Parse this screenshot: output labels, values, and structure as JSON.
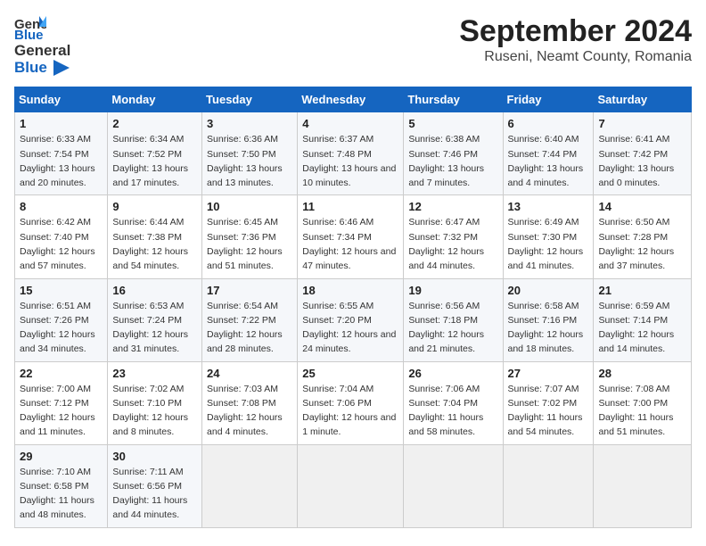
{
  "header": {
    "logo_general": "General",
    "logo_blue": "Blue",
    "title": "September 2024",
    "subtitle": "Ruseni, Neamt County, Romania"
  },
  "columns": [
    "Sunday",
    "Monday",
    "Tuesday",
    "Wednesday",
    "Thursday",
    "Friday",
    "Saturday"
  ],
  "weeks": [
    [
      {
        "day": "1",
        "sunrise": "Sunrise: 6:33 AM",
        "sunset": "Sunset: 7:54 PM",
        "daylight": "Daylight: 13 hours and 20 minutes."
      },
      {
        "day": "2",
        "sunrise": "Sunrise: 6:34 AM",
        "sunset": "Sunset: 7:52 PM",
        "daylight": "Daylight: 13 hours and 17 minutes."
      },
      {
        "day": "3",
        "sunrise": "Sunrise: 6:36 AM",
        "sunset": "Sunset: 7:50 PM",
        "daylight": "Daylight: 13 hours and 13 minutes."
      },
      {
        "day": "4",
        "sunrise": "Sunrise: 6:37 AM",
        "sunset": "Sunset: 7:48 PM",
        "daylight": "Daylight: 13 hours and 10 minutes."
      },
      {
        "day": "5",
        "sunrise": "Sunrise: 6:38 AM",
        "sunset": "Sunset: 7:46 PM",
        "daylight": "Daylight: 13 hours and 7 minutes."
      },
      {
        "day": "6",
        "sunrise": "Sunrise: 6:40 AM",
        "sunset": "Sunset: 7:44 PM",
        "daylight": "Daylight: 13 hours and 4 minutes."
      },
      {
        "day": "7",
        "sunrise": "Sunrise: 6:41 AM",
        "sunset": "Sunset: 7:42 PM",
        "daylight": "Daylight: 13 hours and 0 minutes."
      }
    ],
    [
      {
        "day": "8",
        "sunrise": "Sunrise: 6:42 AM",
        "sunset": "Sunset: 7:40 PM",
        "daylight": "Daylight: 12 hours and 57 minutes."
      },
      {
        "day": "9",
        "sunrise": "Sunrise: 6:44 AM",
        "sunset": "Sunset: 7:38 PM",
        "daylight": "Daylight: 12 hours and 54 minutes."
      },
      {
        "day": "10",
        "sunrise": "Sunrise: 6:45 AM",
        "sunset": "Sunset: 7:36 PM",
        "daylight": "Daylight: 12 hours and 51 minutes."
      },
      {
        "day": "11",
        "sunrise": "Sunrise: 6:46 AM",
        "sunset": "Sunset: 7:34 PM",
        "daylight": "Daylight: 12 hours and 47 minutes."
      },
      {
        "day": "12",
        "sunrise": "Sunrise: 6:47 AM",
        "sunset": "Sunset: 7:32 PM",
        "daylight": "Daylight: 12 hours and 44 minutes."
      },
      {
        "day": "13",
        "sunrise": "Sunrise: 6:49 AM",
        "sunset": "Sunset: 7:30 PM",
        "daylight": "Daylight: 12 hours and 41 minutes."
      },
      {
        "day": "14",
        "sunrise": "Sunrise: 6:50 AM",
        "sunset": "Sunset: 7:28 PM",
        "daylight": "Daylight: 12 hours and 37 minutes."
      }
    ],
    [
      {
        "day": "15",
        "sunrise": "Sunrise: 6:51 AM",
        "sunset": "Sunset: 7:26 PM",
        "daylight": "Daylight: 12 hours and 34 minutes."
      },
      {
        "day": "16",
        "sunrise": "Sunrise: 6:53 AM",
        "sunset": "Sunset: 7:24 PM",
        "daylight": "Daylight: 12 hours and 31 minutes."
      },
      {
        "day": "17",
        "sunrise": "Sunrise: 6:54 AM",
        "sunset": "Sunset: 7:22 PM",
        "daylight": "Daylight: 12 hours and 28 minutes."
      },
      {
        "day": "18",
        "sunrise": "Sunrise: 6:55 AM",
        "sunset": "Sunset: 7:20 PM",
        "daylight": "Daylight: 12 hours and 24 minutes."
      },
      {
        "day": "19",
        "sunrise": "Sunrise: 6:56 AM",
        "sunset": "Sunset: 7:18 PM",
        "daylight": "Daylight: 12 hours and 21 minutes."
      },
      {
        "day": "20",
        "sunrise": "Sunrise: 6:58 AM",
        "sunset": "Sunset: 7:16 PM",
        "daylight": "Daylight: 12 hours and 18 minutes."
      },
      {
        "day": "21",
        "sunrise": "Sunrise: 6:59 AM",
        "sunset": "Sunset: 7:14 PM",
        "daylight": "Daylight: 12 hours and 14 minutes."
      }
    ],
    [
      {
        "day": "22",
        "sunrise": "Sunrise: 7:00 AM",
        "sunset": "Sunset: 7:12 PM",
        "daylight": "Daylight: 12 hours and 11 minutes."
      },
      {
        "day": "23",
        "sunrise": "Sunrise: 7:02 AM",
        "sunset": "Sunset: 7:10 PM",
        "daylight": "Daylight: 12 hours and 8 minutes."
      },
      {
        "day": "24",
        "sunrise": "Sunrise: 7:03 AM",
        "sunset": "Sunset: 7:08 PM",
        "daylight": "Daylight: 12 hours and 4 minutes."
      },
      {
        "day": "25",
        "sunrise": "Sunrise: 7:04 AM",
        "sunset": "Sunset: 7:06 PM",
        "daylight": "Daylight: 12 hours and 1 minute."
      },
      {
        "day": "26",
        "sunrise": "Sunrise: 7:06 AM",
        "sunset": "Sunset: 7:04 PM",
        "daylight": "Daylight: 11 hours and 58 minutes."
      },
      {
        "day": "27",
        "sunrise": "Sunrise: 7:07 AM",
        "sunset": "Sunset: 7:02 PM",
        "daylight": "Daylight: 11 hours and 54 minutes."
      },
      {
        "day": "28",
        "sunrise": "Sunrise: 7:08 AM",
        "sunset": "Sunset: 7:00 PM",
        "daylight": "Daylight: 11 hours and 51 minutes."
      }
    ],
    [
      {
        "day": "29",
        "sunrise": "Sunrise: 7:10 AM",
        "sunset": "Sunset: 6:58 PM",
        "daylight": "Daylight: 11 hours and 48 minutes."
      },
      {
        "day": "30",
        "sunrise": "Sunrise: 7:11 AM",
        "sunset": "Sunset: 6:56 PM",
        "daylight": "Daylight: 11 hours and 44 minutes."
      },
      null,
      null,
      null,
      null,
      null
    ]
  ]
}
